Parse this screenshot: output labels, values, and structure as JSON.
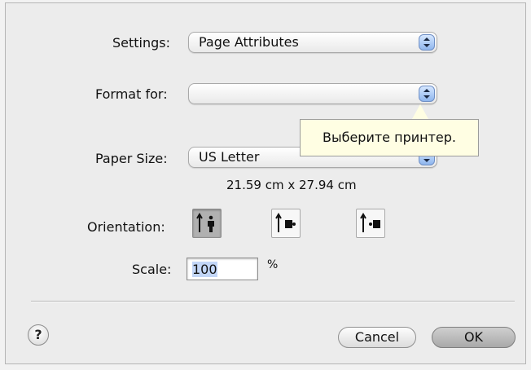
{
  "settings": {
    "label": "Settings:",
    "value": "Page Attributes"
  },
  "format_for": {
    "label": "Format for:",
    "value": ""
  },
  "tooltip": {
    "text": "Выберите принтер."
  },
  "paper_size": {
    "label": "Paper Size:",
    "value": "US Letter",
    "dimensions": "21.59 cm x 27.94 cm"
  },
  "orientation": {
    "label": "Orientation:",
    "options": [
      "portrait",
      "landscape-left",
      "landscape-right"
    ],
    "selected": "portrait"
  },
  "scale": {
    "label": "Scale:",
    "value": "100",
    "unit": "%"
  },
  "buttons": {
    "help": "?",
    "cancel": "Cancel",
    "ok": "OK"
  },
  "colors": {
    "tooltip_bg": "#fffee3",
    "popup_arrow_accent": "#8fb6ee"
  }
}
